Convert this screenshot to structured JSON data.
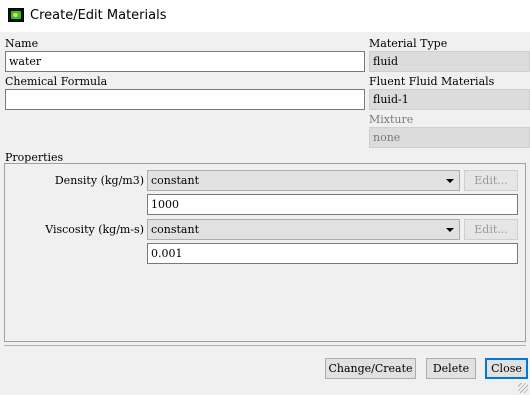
{
  "window": {
    "title": "Create/Edit Materials",
    "icon": "fluent-app-icon"
  },
  "name": {
    "label": "Name",
    "value": "water"
  },
  "chemical_formula": {
    "label": "Chemical Formula",
    "value": ""
  },
  "material_type": {
    "label": "Material Type",
    "value": "fluid"
  },
  "fluent_fluid_materials": {
    "label": "Fluent Fluid Materials",
    "value": "fluid-1"
  },
  "mixture": {
    "label": "Mixture",
    "value": "none"
  },
  "properties": {
    "label": "Properties",
    "rows": [
      {
        "label": "Density (kg/m3)",
        "method": "constant",
        "edit_label": "Edit...",
        "value": "1000"
      },
      {
        "label": "Viscosity (kg/m-s)",
        "method": "constant",
        "edit_label": "Edit...",
        "value": "0.001"
      }
    ]
  },
  "buttons": {
    "change_create": "Change/Create",
    "delete": "Delete",
    "close": "Close"
  }
}
